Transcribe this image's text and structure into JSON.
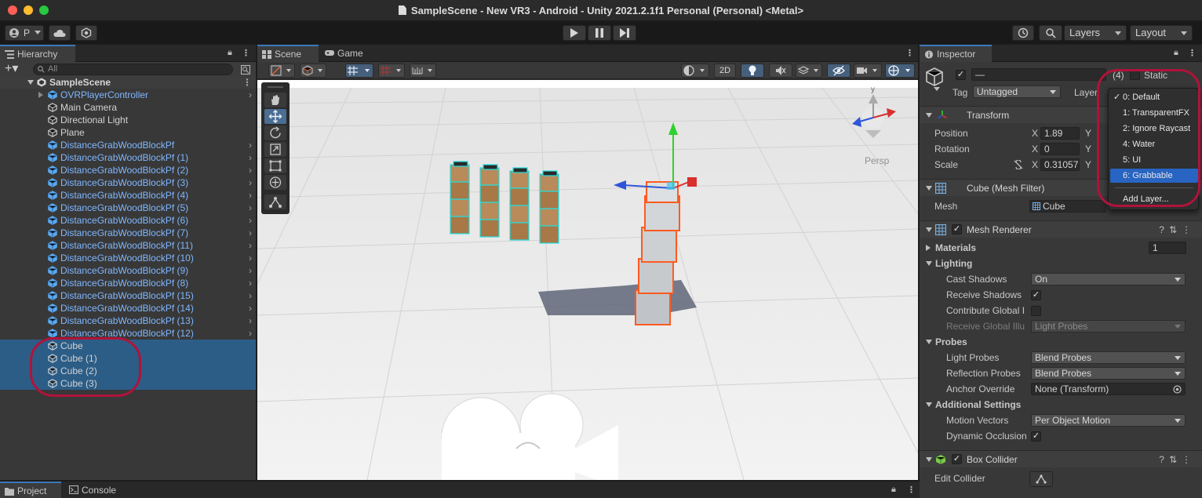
{
  "window": {
    "title": "SampleScene - New VR3 - Android - Unity 2021.2.1f1 Personal (Personal) <Metal>"
  },
  "toolbar": {
    "account_label": "P",
    "layers_label": "Layers",
    "layout_label": "Layout"
  },
  "hierarchy": {
    "tab_label": "Hierarchy",
    "search_placeholder": "All",
    "scene_name": "SampleScene",
    "items": [
      {
        "label": "OVRPlayerController",
        "prefab": true,
        "expandable": true,
        "children": true
      },
      {
        "label": "Main Camera",
        "prefab": false
      },
      {
        "label": "Directional Light",
        "prefab": false
      },
      {
        "label": "Plane",
        "prefab": false
      },
      {
        "label": "DistanceGrabWoodBlockPf",
        "prefab": true
      },
      {
        "label": "DistanceGrabWoodBlockPf (1)",
        "prefab": true
      },
      {
        "label": "DistanceGrabWoodBlockPf (2)",
        "prefab": true
      },
      {
        "label": "DistanceGrabWoodBlockPf (3)",
        "prefab": true
      },
      {
        "label": "DistanceGrabWoodBlockPf (4)",
        "prefab": true
      },
      {
        "label": "DistanceGrabWoodBlockPf (5)",
        "prefab": true
      },
      {
        "label": "DistanceGrabWoodBlockPf (6)",
        "prefab": true
      },
      {
        "label": "DistanceGrabWoodBlockPf (7)",
        "prefab": true
      },
      {
        "label": "DistanceGrabWoodBlockPf (11)",
        "prefab": true
      },
      {
        "label": "DistanceGrabWoodBlockPf (10)",
        "prefab": true
      },
      {
        "label": "DistanceGrabWoodBlockPf (9)",
        "prefab": true
      },
      {
        "label": "DistanceGrabWoodBlockPf (8)",
        "prefab": true
      },
      {
        "label": "DistanceGrabWoodBlockPf (15)",
        "prefab": true
      },
      {
        "label": "DistanceGrabWoodBlockPf (14)",
        "prefab": true
      },
      {
        "label": "DistanceGrabWoodBlockPf (13)",
        "prefab": true
      },
      {
        "label": "DistanceGrabWoodBlockPf (12)",
        "prefab": true
      },
      {
        "label": "Cube",
        "prefab": false,
        "selected": true
      },
      {
        "label": "Cube (1)",
        "prefab": false,
        "selected": true
      },
      {
        "label": "Cube (2)",
        "prefab": false,
        "selected": true
      },
      {
        "label": "Cube (3)",
        "prefab": false,
        "selected": true
      }
    ]
  },
  "scene": {
    "tabs": [
      "Scene",
      "Game"
    ],
    "two_d_label": "2D",
    "gizmo_axis_label": "y",
    "persp_label": "Persp"
  },
  "inspector": {
    "tab_label": "Inspector",
    "object_name": "—",
    "count": "(4)",
    "static_label": "Static",
    "tag_label": "Tag",
    "tag_value": "Untagged",
    "layer_label": "Layer",
    "transform": {
      "title": "Transform",
      "position_label": "Position",
      "rotation_label": "Rotation",
      "scale_label": "Scale",
      "x_label": "X",
      "y_label": "Y",
      "position_x": "1.89",
      "rotation_x": "0",
      "scale_x": "0.31057"
    },
    "mesh_filter": {
      "title": "Cube (Mesh Filter)",
      "mesh_label": "Mesh",
      "mesh_value": "Cube"
    },
    "mesh_renderer": {
      "title": "Mesh Renderer",
      "materials_label": "Materials",
      "materials_count": "1",
      "lighting_label": "Lighting",
      "cast_shadows_label": "Cast Shadows",
      "cast_shadows_value": "On",
      "receive_shadows_label": "Receive Shadows",
      "contribute_gi_label": "Contribute Global I",
      "receive_gi_label": "Receive Global Illu",
      "receive_gi_value": "Light Probes",
      "probes_label": "Probes",
      "light_probes_label": "Light Probes",
      "light_probes_value": "Blend Probes",
      "reflection_probes_label": "Reflection Probes",
      "reflection_probes_value": "Blend Probes",
      "anchor_override_label": "Anchor Override",
      "anchor_override_value": "None (Transform)",
      "additional_settings_label": "Additional Settings",
      "motion_vectors_label": "Motion Vectors",
      "motion_vectors_value": "Per Object Motion",
      "dynamic_occlusion_label": "Dynamic Occlusion"
    },
    "box_collider": {
      "title": "Box Collider",
      "edit_collider_label": "Edit Collider"
    }
  },
  "layer_popup": {
    "items": [
      {
        "label": "0: Default",
        "checked": true,
        "selected": false
      },
      {
        "label": "1: TransparentFX",
        "checked": false,
        "selected": false
      },
      {
        "label": "2: Ignore Raycast",
        "checked": false,
        "selected": false
      },
      {
        "label": "4: Water",
        "checked": false,
        "selected": false
      },
      {
        "label": "5: UI",
        "checked": false,
        "selected": false
      },
      {
        "label": "6: Grabbable",
        "checked": false,
        "selected": true
      }
    ],
    "add_layer_label": "Add Layer...",
    "check_glyph": "✓"
  },
  "bottom": {
    "project_label": "Project",
    "console_label": "Console"
  },
  "colors": {
    "selection": "#2c5d87",
    "highlight_circle": "#b0133a",
    "prefab_text": "#7fb7ff",
    "popup_selected": "#2864c2",
    "accent_tab": "#3a79bb"
  }
}
